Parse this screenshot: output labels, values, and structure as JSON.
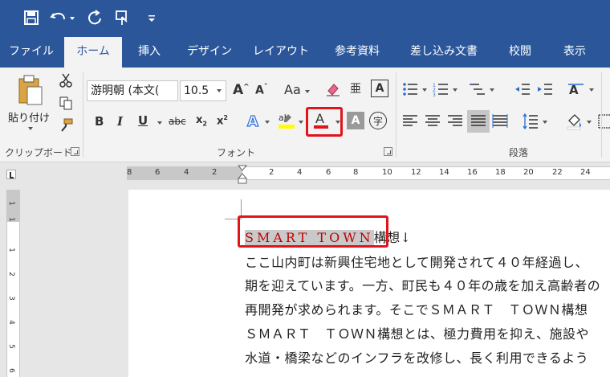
{
  "tabs": [
    "ファイル",
    "ホーム",
    "挿入",
    "デザイン",
    "レイアウト",
    "参考資料",
    "差し込み文書",
    "校閲",
    "表示"
  ],
  "ribbon": {
    "clipboard": {
      "label": "クリップボード",
      "paste": "貼り付け"
    },
    "font": {
      "label": "フォント",
      "font_name": "游明朝 (本文(",
      "font_size": "10.5"
    },
    "paragraph": {
      "label": "段落"
    }
  },
  "ruler": {
    "horizontal": [
      "8",
      "6",
      "4",
      "2",
      "2",
      "4",
      "6",
      "8",
      "10",
      "12",
      "14",
      "16",
      "18",
      "20",
      "22",
      "24"
    ],
    "vertical": [
      "1",
      "1",
      "1",
      "2",
      "3",
      "4",
      "5",
      "6"
    ]
  },
  "document": {
    "heading_selected": "SMART TOWN",
    "heading_rest": "構想↓",
    "lines": [
      "ここ山内町は新興住宅地として開発されて４０年経過し、",
      "期を迎えています。一方、町民も４０年の歳を加え高齢者の",
      "再開発が求められます。そこでＳＭＡＲＴ　ＴＯＷＮ構想",
      "ＳＭＡＲＴ　ＴＯＷＮ構想とは、極力費用を抑え、施設や",
      "水道・橋梁などのインフラを改修し、長く利用できるよう"
    ]
  },
  "colors": {
    "title_bar": "#2b579a",
    "font_color": "#e0151c",
    "highlight_box": "#e0151c",
    "selection": "#c9c9c9"
  }
}
